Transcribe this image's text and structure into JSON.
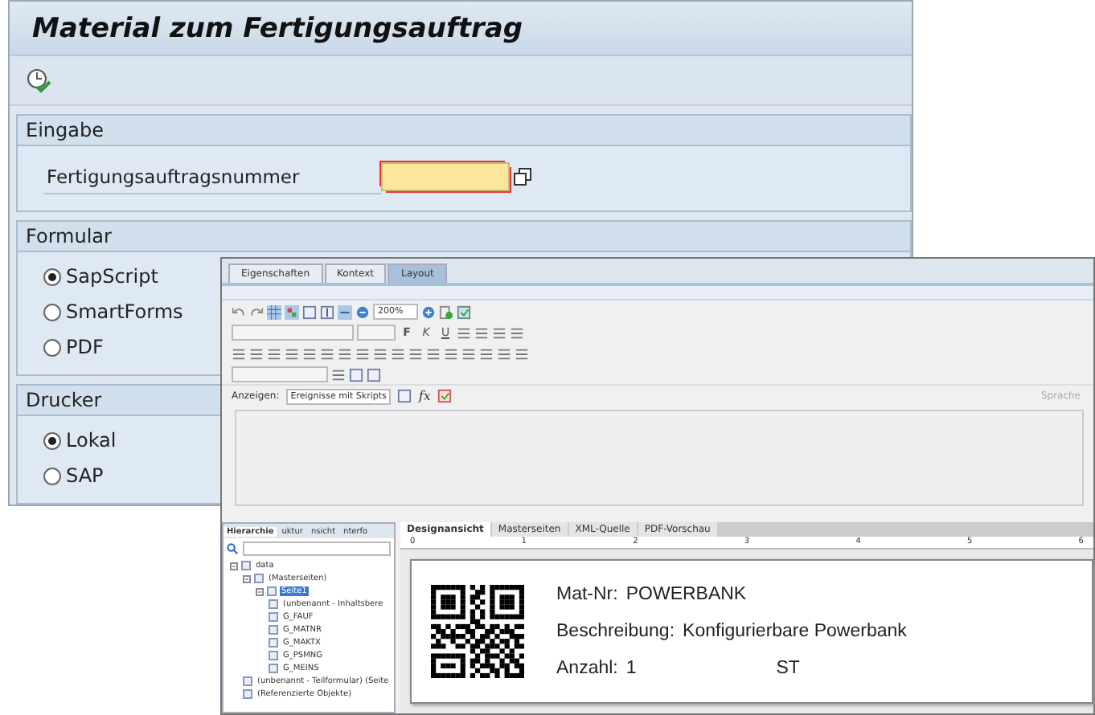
{
  "window": {
    "title": "Material zum Fertigungsauftrag"
  },
  "groups": [
    {
      "title": "Eingabe",
      "kind": "fields",
      "fields": [
        {
          "label": "Fertigungsauftragsnummer",
          "required": true
        }
      ]
    },
    {
      "title": "Formular",
      "kind": "radios",
      "options": [
        {
          "label": "SapScript",
          "selected": true
        },
        {
          "label": "SmartForms",
          "selected": false
        },
        {
          "label": "PDF",
          "selected": false
        }
      ]
    },
    {
      "title": "Drucker",
      "kind": "radios",
      "options": [
        {
          "label": "Lokal",
          "selected": true
        },
        {
          "label": "SAP",
          "selected": false
        }
      ]
    }
  ],
  "designer": {
    "tabs": [
      {
        "label": "Eigenschaften",
        "selected": false
      },
      {
        "label": "Kontext",
        "selected": false
      },
      {
        "label": "Layout",
        "selected": true
      }
    ],
    "zoom": "200%",
    "format_buttons": [
      "F",
      "K",
      "U"
    ],
    "show_label": "Anzeigen:",
    "show_value": "Ereignisse mit Skripts",
    "function_symbol": "fx",
    "language_label": "Sprache",
    "panel_tabs": [
      {
        "label": "Hierarchie",
        "selected": true
      },
      {
        "label": "uktur",
        "selected": false
      },
      {
        "label": "nsicht",
        "selected": false
      },
      {
        "label": "nterfo",
        "selected": false
      }
    ],
    "tree": [
      {
        "label": "data",
        "selected": false,
        "expanded": true,
        "children": [
          {
            "label": "(Masterseiten)",
            "selected": false,
            "expanded": true,
            "children": [
              {
                "label": "Seite1",
                "selected": true,
                "expanded": true,
                "children": [
                  {
                    "label": "(unbenannt - Inhaltsbere",
                    "selected": false
                  },
                  {
                    "label": "G_FAUF",
                    "selected": false
                  },
                  {
                    "label": "G_MATNR",
                    "selected": false
                  },
                  {
                    "label": "G_MAKTX",
                    "selected": false
                  },
                  {
                    "label": "G_PSMNG",
                    "selected": false
                  },
                  {
                    "label": "G_MEINS",
                    "selected": false
                  }
                ]
              }
            ]
          },
          {
            "label": "(unbenannt - Teilformular) (Seite",
            "selected": false
          },
          {
            "label": "(Referenzierte Objekte)",
            "selected": false
          }
        ]
      }
    ],
    "view_tabs": [
      {
        "label": "Designansicht",
        "selected": true
      },
      {
        "label": "Masterseiten",
        "selected": false
      },
      {
        "label": "XML-Quelle",
        "selected": false
      },
      {
        "label": "PDF-Vorschau",
        "selected": false
      }
    ],
    "ruler": [
      "0",
      "1",
      "2",
      "3",
      "4",
      "5",
      "6"
    ],
    "label_lines": [
      {
        "label": "Mat-Nr:",
        "value": "POWERBANK"
      },
      {
        "label": "Beschreibung:",
        "value": "Konfigurierbare Powerbank"
      },
      {
        "label": "Anzahl:",
        "value": "1",
        "unit": "ST"
      }
    ]
  }
}
